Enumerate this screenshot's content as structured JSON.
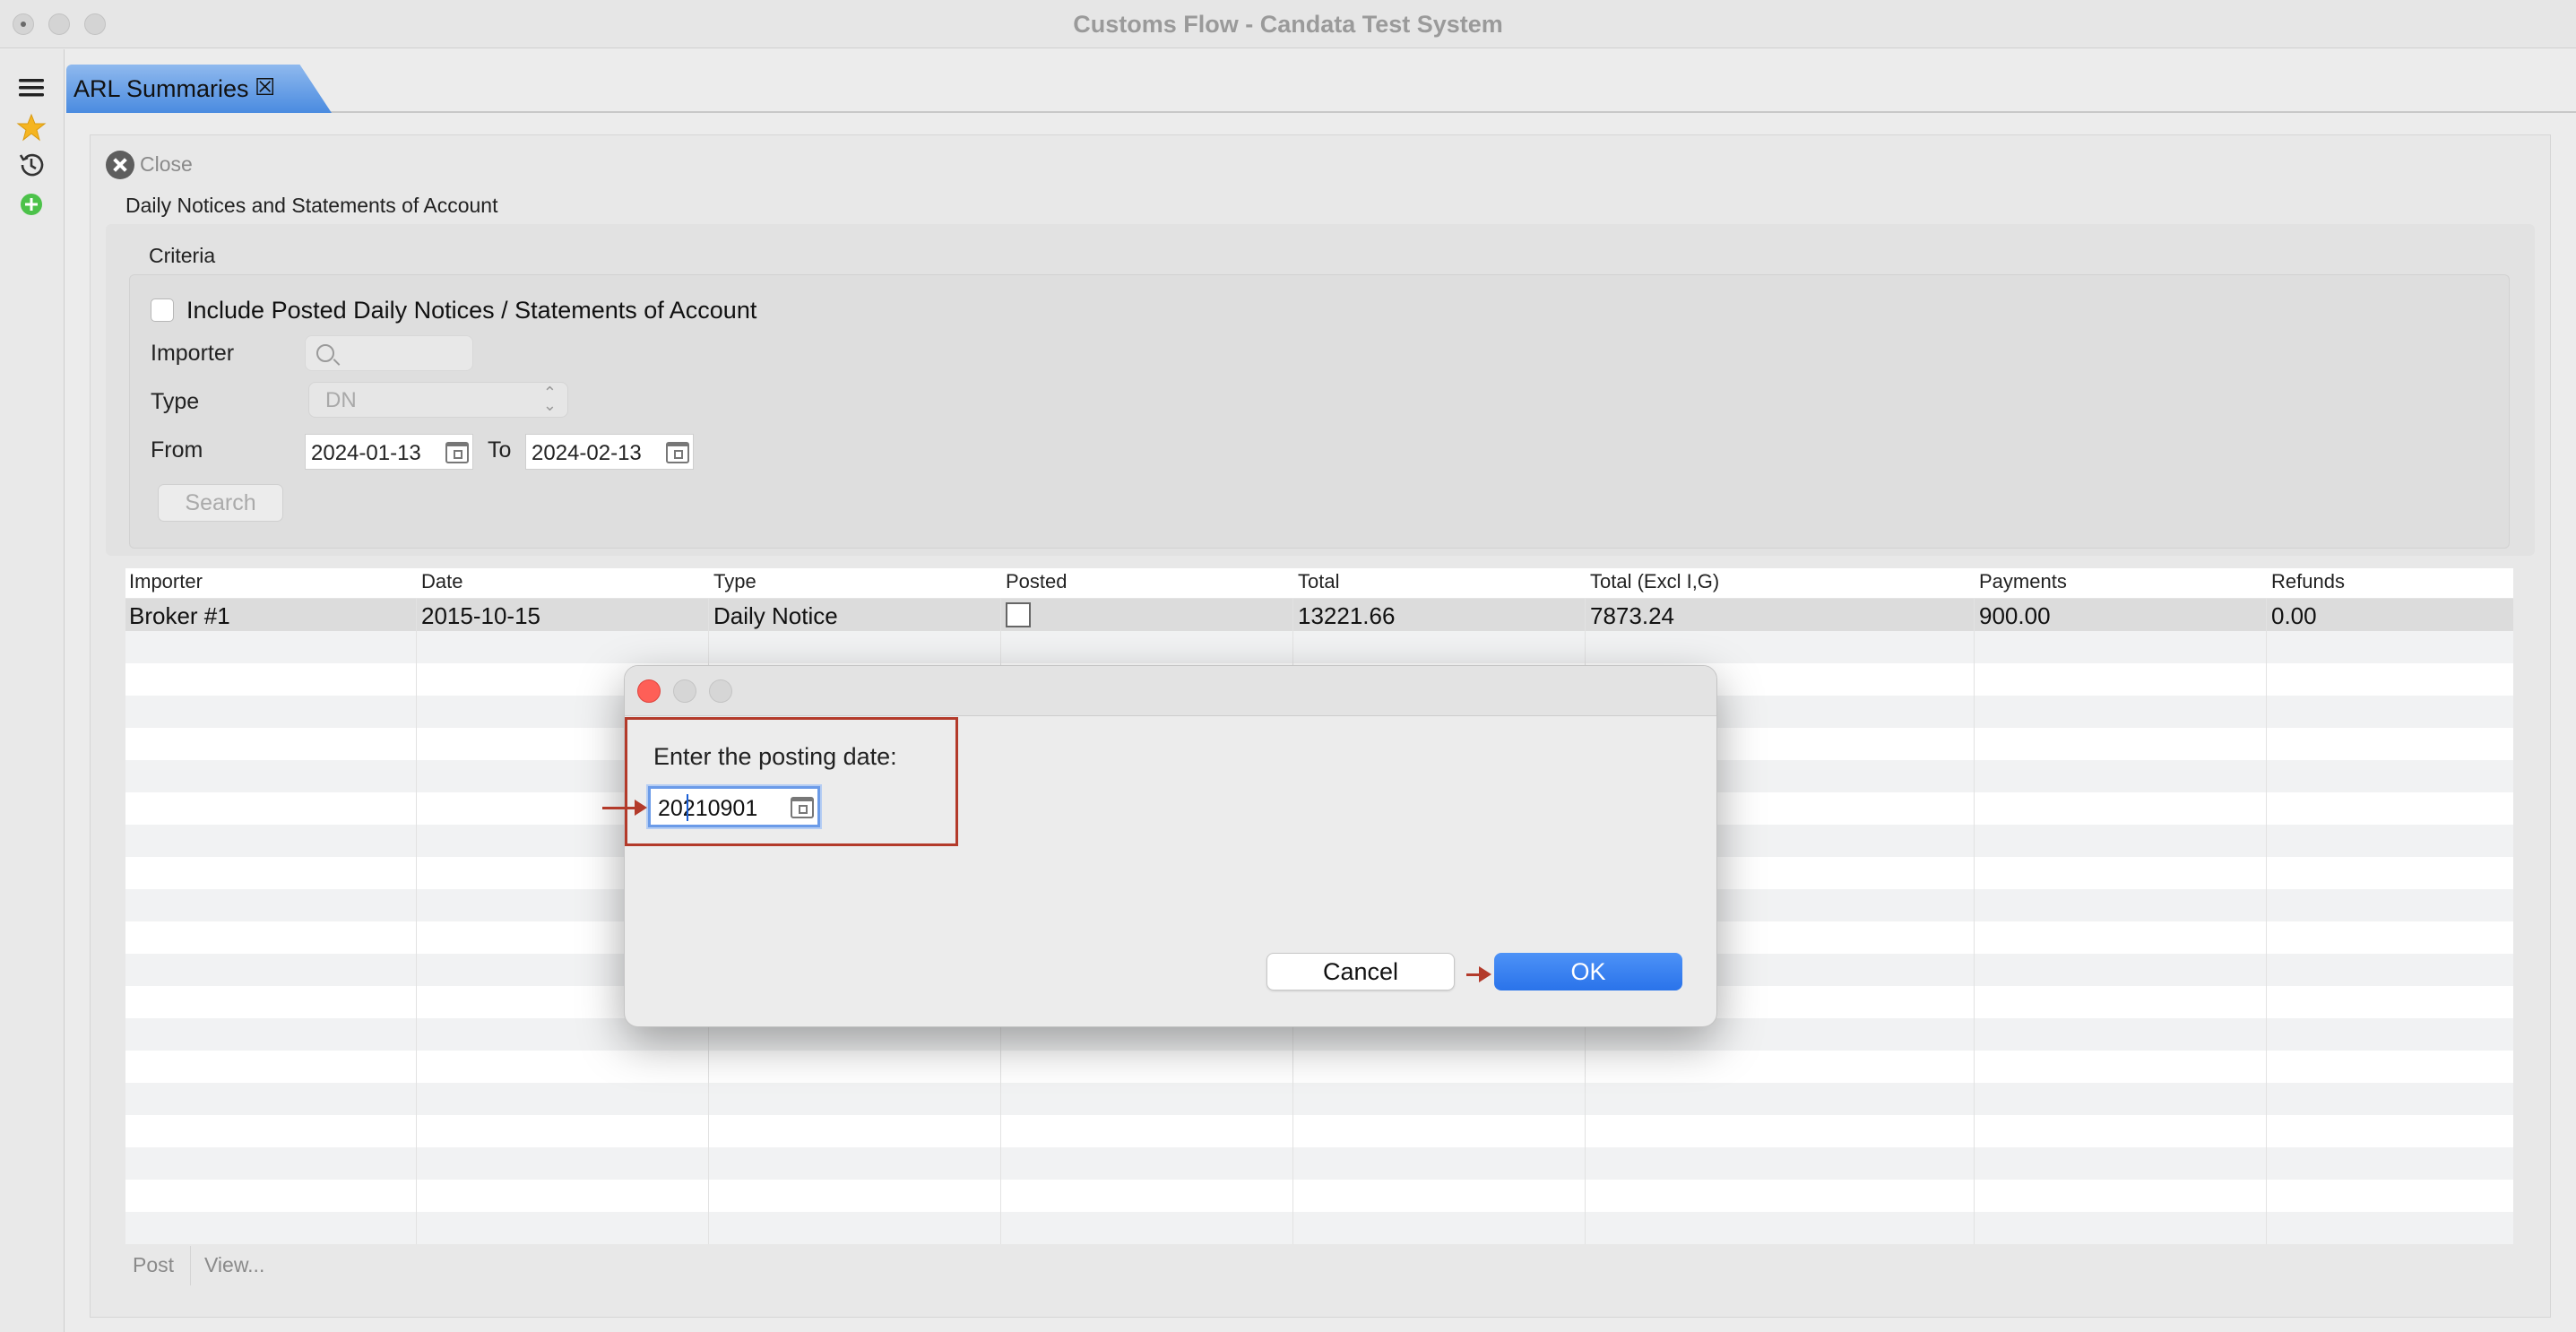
{
  "window": {
    "title": "Customs Flow - Candata Test System"
  },
  "left_toolbar": {
    "icons": [
      "menu-icon",
      "star-icon",
      "history-icon",
      "add-icon"
    ]
  },
  "tab": {
    "label": "ARL Summaries",
    "close_icon": "close-tab-icon"
  },
  "page": {
    "close_label": "Close",
    "section_title": "Daily Notices and Statements of Account"
  },
  "criteria": {
    "title": "Criteria",
    "include_posted_label": "Include Posted Daily Notices / Statements of Account",
    "include_posted_checked": false,
    "importer_label": "Importer",
    "importer_value": "",
    "type_label": "Type",
    "type_value": "DN",
    "from_label": "From",
    "from_value": "2024-01-13",
    "to_label": "To",
    "to_value": "2024-02-13",
    "search_label": "Search"
  },
  "table": {
    "columns": [
      "Importer",
      "Date",
      "Type",
      "Posted",
      "Total",
      "Total (Excl I,G)",
      "Payments",
      "Refunds"
    ],
    "rows": [
      {
        "importer": "Broker #1",
        "date": "2015-10-15",
        "type": "Daily Notice",
        "posted": false,
        "total": "13221.66",
        "total_excl": "7873.24",
        "payments": "900.00",
        "refunds": "0.00"
      }
    ]
  },
  "footer": {
    "post_label": "Post",
    "view_label": "View..."
  },
  "dialog": {
    "prompt": "Enter the posting date:",
    "posting_date_value": "20210901",
    "cancel_label": "Cancel",
    "ok_label": "OK"
  },
  "colors": {
    "accent": "#2a73ea",
    "tab_active": "#4a8be0",
    "annotation": "#b33a2a",
    "close_red": "#fe5f57"
  }
}
